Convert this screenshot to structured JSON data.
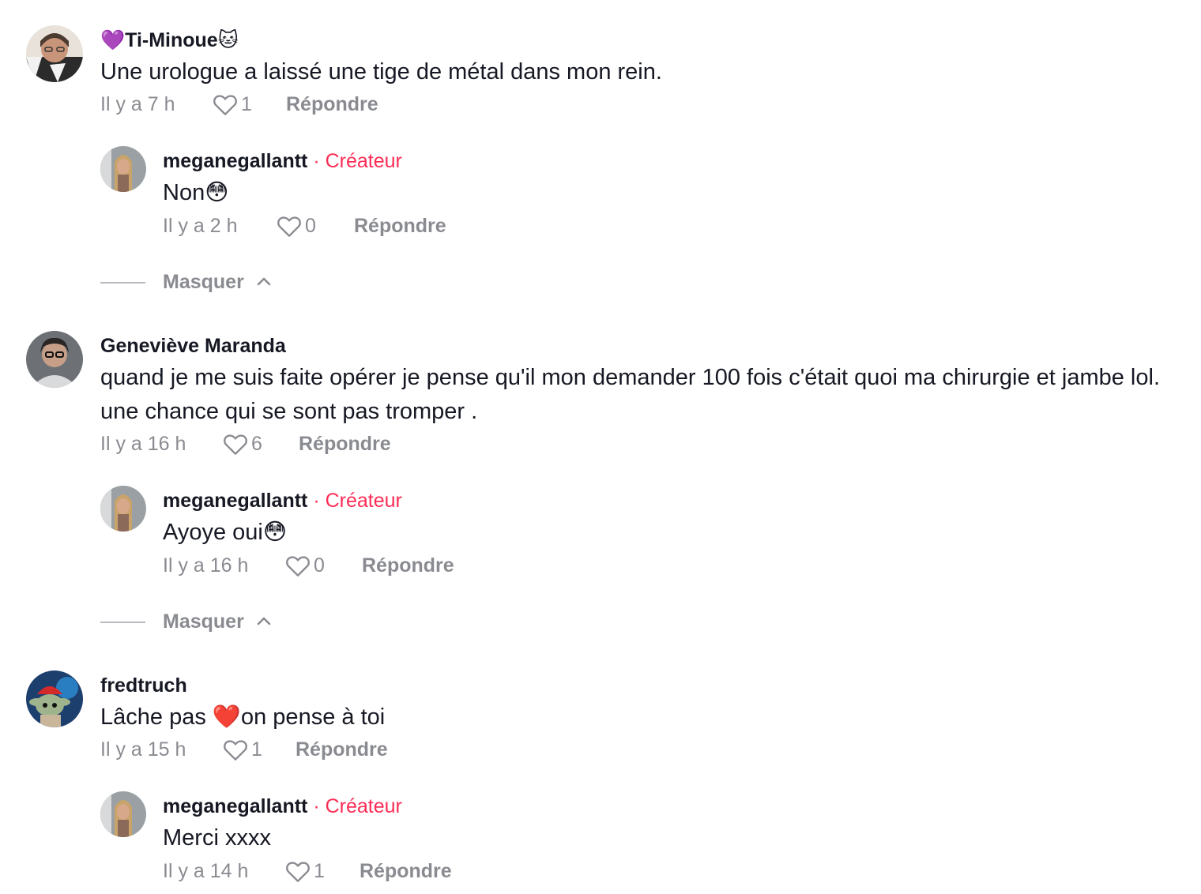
{
  "comments": [
    {
      "username": "💜Ti-Minoue🐱",
      "text": "Une urologue a laissé une tige de métal dans mon rein.",
      "time": "Il y a 7 h",
      "likes": "1",
      "reply_label": "Répondre",
      "reply": {
        "username": "meganegallantt",
        "creator_label": "Créateur",
        "text": "Non😳",
        "time": "Il y a 2 h",
        "likes": "0",
        "reply_label": "Répondre"
      },
      "hide_label": "Masquer"
    },
    {
      "username": "Geneviève Maranda",
      "text_line1": "quand je me suis faite opérer je pense qu'il mon demander 100 fois c'était quoi ma chirurgie et jambe lol.",
      "text_line2": "une chance qui se sont pas tromper .",
      "time": "Il y a 16 h",
      "likes": "6",
      "reply_label": "Répondre",
      "reply": {
        "username": "meganegallantt",
        "creator_label": "Créateur",
        "text": "Ayoye oui😳",
        "time": "Il y a 16 h",
        "likes": "0",
        "reply_label": "Répondre"
      },
      "hide_label": "Masquer"
    },
    {
      "username": "fredtruch",
      "text": "Lâche pas ❤️on pense à toi",
      "time": "Il y a 15 h",
      "likes": "1",
      "reply_label": "Répondre",
      "reply": {
        "username": "meganegallantt",
        "creator_label": "Créateur",
        "text": "Merci xxxx",
        "time": "Il y a 14 h",
        "likes": "1",
        "reply_label": "Répondre"
      }
    }
  ],
  "separator": "·",
  "colors": {
    "creator": "#fe2c55",
    "meta": "#8a8b91",
    "text": "#161823"
  },
  "icons": {
    "like": "heart-outline-icon",
    "hide": "chevron-up-icon"
  }
}
